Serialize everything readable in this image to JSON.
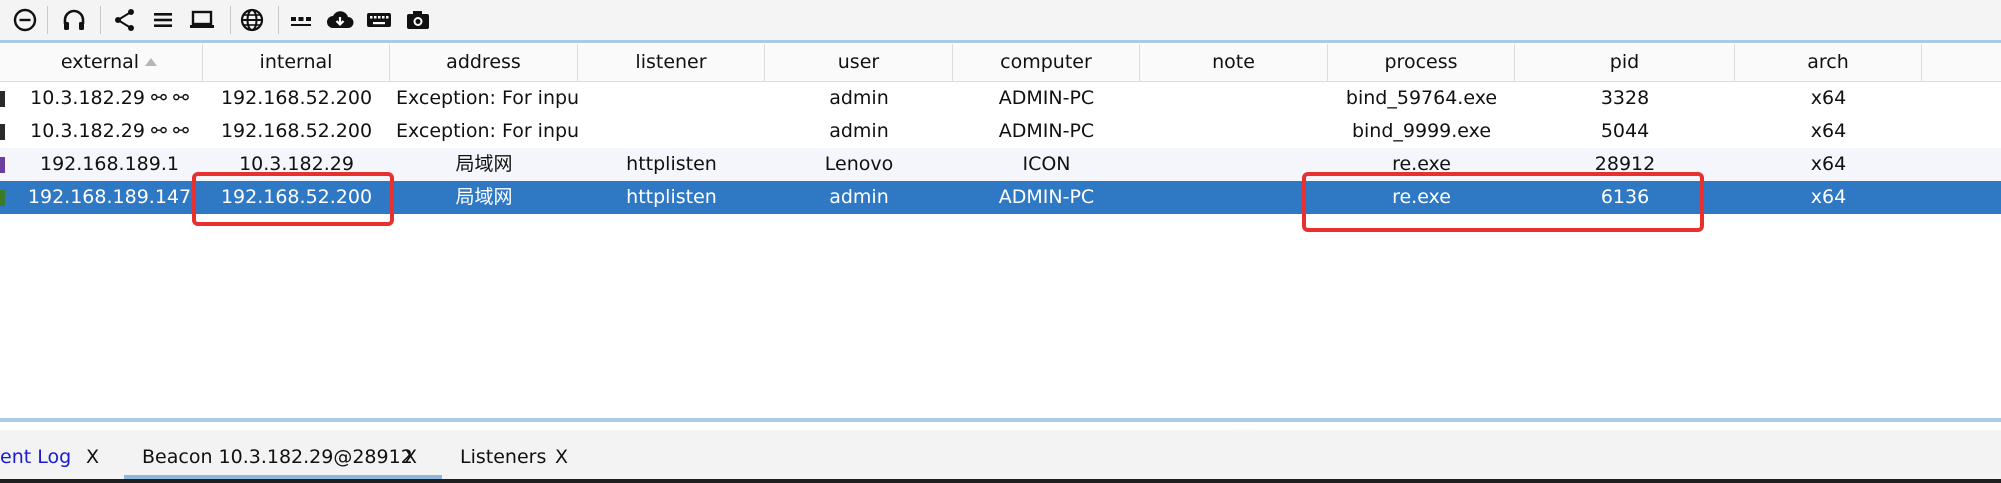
{
  "toolbar": {
    "icons": [
      "disconnect-icon",
      "headphones-icon",
      "share-graph-icon",
      "list-icon",
      "laptop-icon",
      "globe-icon",
      "dots-icon",
      "cloud-download-icon",
      "keyboard-icon",
      "camera-icon"
    ]
  },
  "table": {
    "columns": [
      "external",
      "internal",
      "address",
      "listener",
      "user",
      "computer",
      "note",
      "process",
      "pid",
      "arch"
    ],
    "sort_column": "external",
    "rows": [
      {
        "external": "10.3.182.29 ⚯ ⚯",
        "internal": "192.168.52.200",
        "address": "Exception: For inpu...",
        "listener": "",
        "user": "admin",
        "computer": "ADMIN-PC",
        "note": "",
        "process": "bind_59764.exe",
        "pid": "3328",
        "arch": "x64"
      },
      {
        "external": "10.3.182.29 ⚯ ⚯",
        "internal": "192.168.52.200",
        "address": "Exception: For inpu...",
        "listener": "",
        "user": "admin",
        "computer": "ADMIN-PC",
        "note": "",
        "process": "bind_9999.exe",
        "pid": "5044",
        "arch": "x64"
      },
      {
        "external": "192.168.189.1",
        "internal": "10.3.182.29",
        "address": "局域网",
        "listener": "httplisten",
        "user": "Lenovo",
        "computer": "ICON",
        "note": "",
        "process": "re.exe",
        "pid": "28912",
        "arch": "x64"
      },
      {
        "external": "192.168.189.147",
        "internal": "192.168.52.200",
        "address": "局域网",
        "listener": "httplisten",
        "user": "admin",
        "computer": "ADMIN-PC",
        "note": "",
        "process": "re.exe",
        "pid": "6136",
        "arch": "x64"
      }
    ]
  },
  "tabs": [
    {
      "label": "ent Log",
      "close": "X"
    },
    {
      "label": "Beacon 10.3.182.29@28912",
      "close": "X"
    },
    {
      "label": "Listeners",
      "close": "X"
    }
  ],
  "colors": {
    "selection": "#2f78c4",
    "highlight": "#e8312f",
    "tab_link": "#1a1ad6"
  }
}
